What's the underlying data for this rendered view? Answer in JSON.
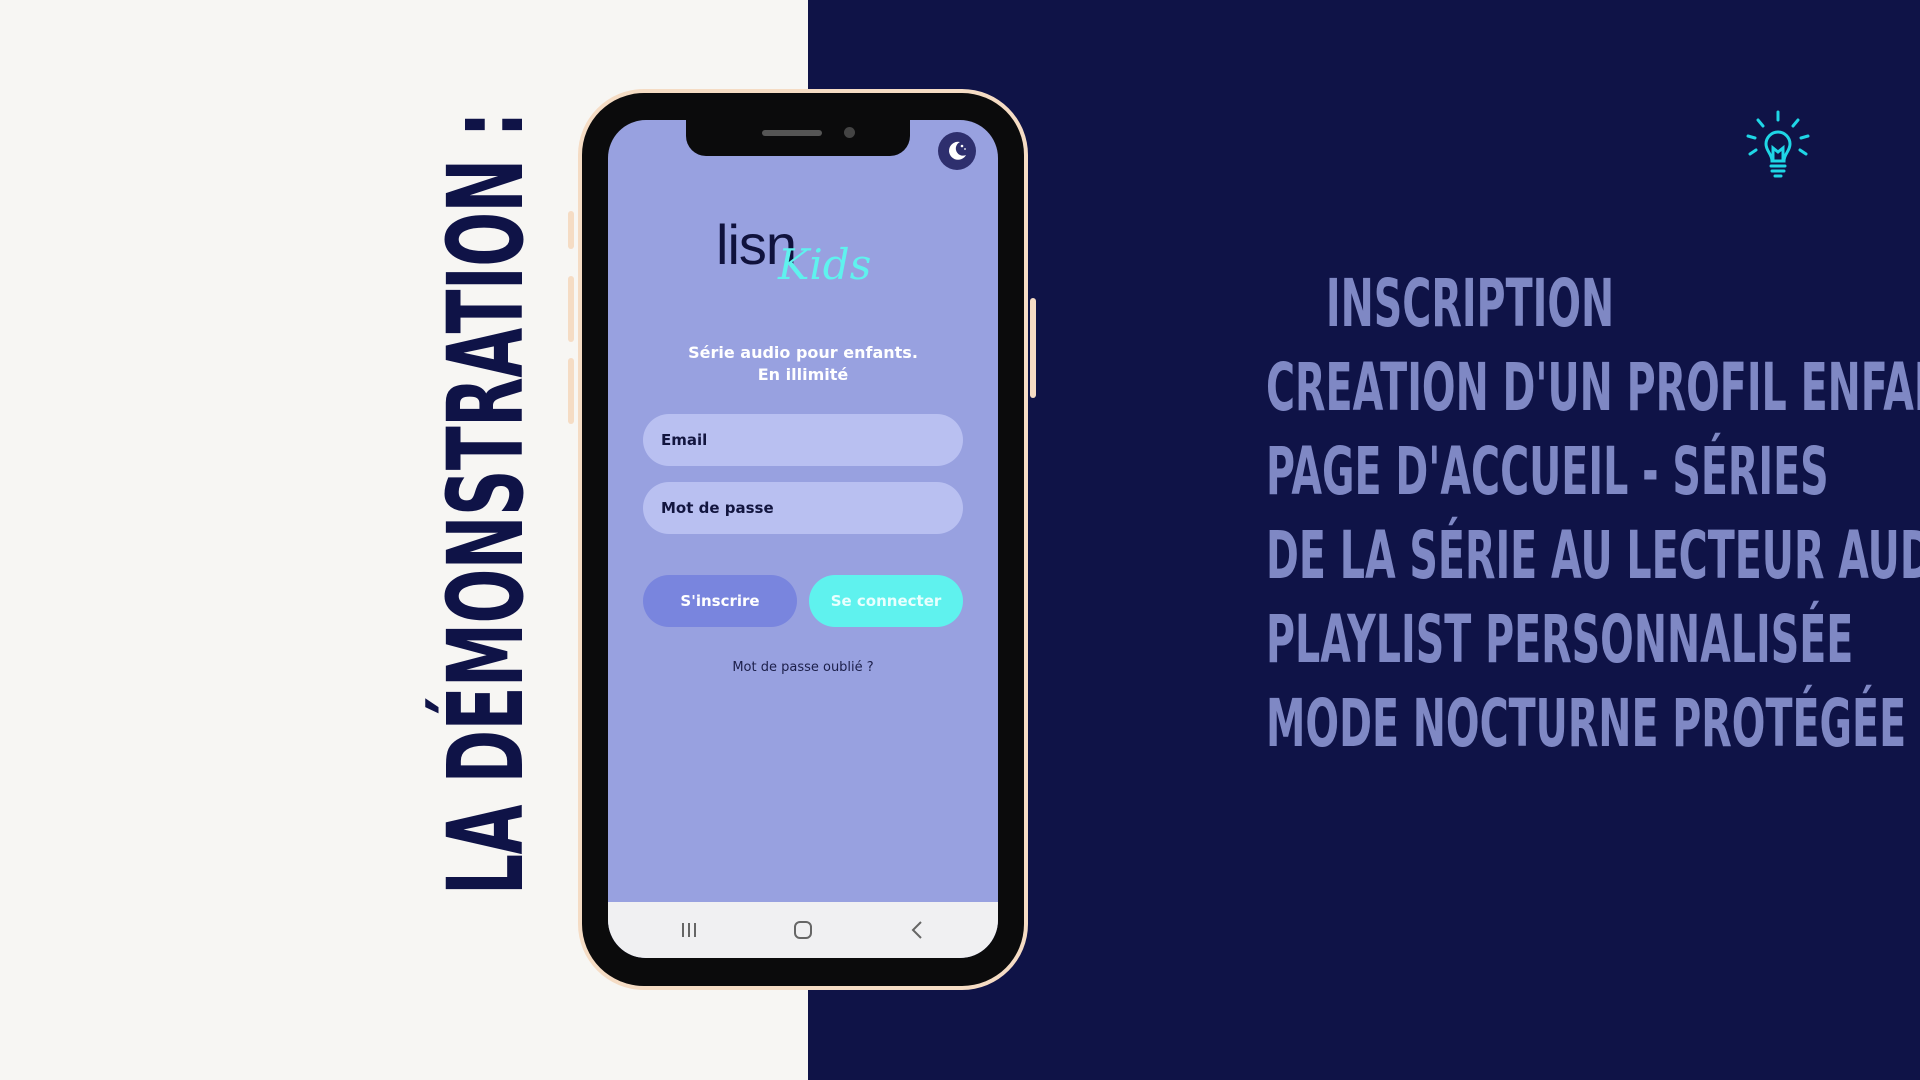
{
  "colors": {
    "background_left": "#f7f6f3",
    "background_right": "#0f1347",
    "title_color": "#0f1347",
    "feature_color": "#7f88c4",
    "accent": "#5ff2ee",
    "screen_bg": "#98a1e0"
  },
  "slide": {
    "vertical_title": "LA DÉMONSTRATION :",
    "features": [
      "INSCRIPTION",
      "CREATION D'UN PROFIL ENFANT",
      "PAGE D'ACCUEIL - SÉRIES",
      "DE LA SÉRIE AU LECTEUR AUDIO",
      "PLAYLIST PERSONNALISÉE",
      "MODE NOCTURNE PROTÉGÉE"
    ],
    "corner_icon": "lightbulb-icon"
  },
  "app": {
    "logo_main": "lisn",
    "logo_sub": "Kids",
    "tagline_line1": "Série audio pour enfants.",
    "tagline_line2": "En illimité",
    "email_placeholder": "Email",
    "password_placeholder": "Mot de passe",
    "register_label": "S'inscrire",
    "login_label": "Se connecter",
    "forgot_label": "Mot de passe oublié ?",
    "night_mode_icon": "moon-icon",
    "nav_icons": [
      "recent-apps-icon",
      "home-icon",
      "back-icon"
    ]
  }
}
